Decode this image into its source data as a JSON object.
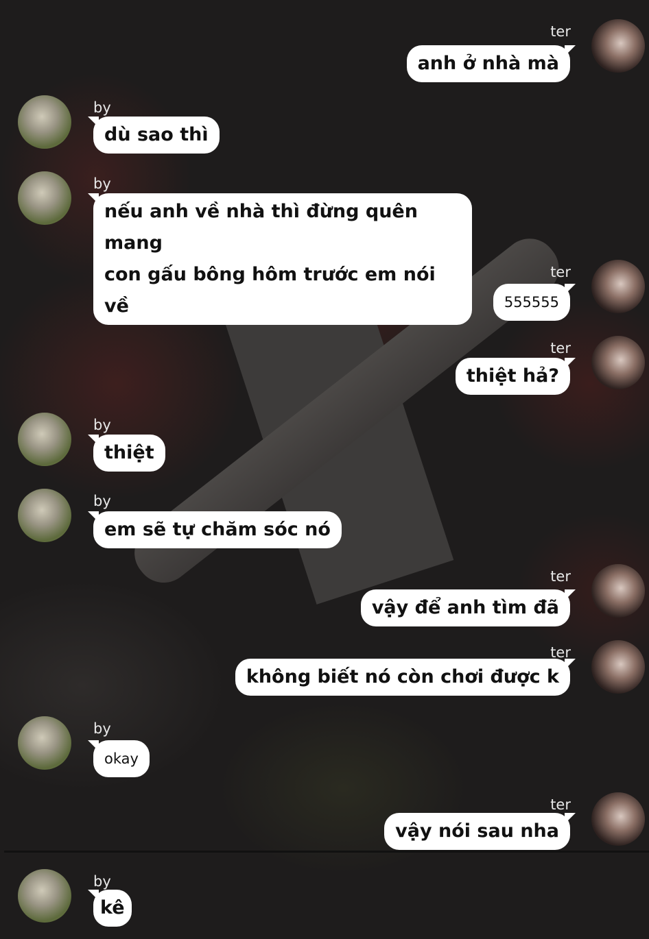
{
  "names": {
    "by": "by",
    "ter": "ter"
  },
  "avatars": {
    "by": "",
    "ter": ""
  },
  "messages": [
    {
      "sender": "ter",
      "text": "anh ở nhà mà"
    },
    {
      "sender": "by",
      "text": "dù sao thì"
    },
    {
      "sender": "by",
      "lines": [
        "nếu anh về nhà thì đừng quên mang",
        "con gấu bông hôm trước em nói về"
      ]
    },
    {
      "sender": "ter",
      "text": "555555"
    },
    {
      "sender": "ter",
      "text": "thiệt hả?"
    },
    {
      "sender": "by",
      "text": "thiệt"
    },
    {
      "sender": "by",
      "text": "em sẽ tự chăm sóc nó"
    },
    {
      "sender": "ter",
      "text": "vậy để anh tìm đã"
    },
    {
      "sender": "ter",
      "text": "không biết nó còn chơi được k"
    },
    {
      "sender": "by",
      "text": "okay"
    },
    {
      "sender": "ter",
      "text": "vậy nói sau nha"
    },
    {
      "sender": "by",
      "text": "kê"
    }
  ]
}
